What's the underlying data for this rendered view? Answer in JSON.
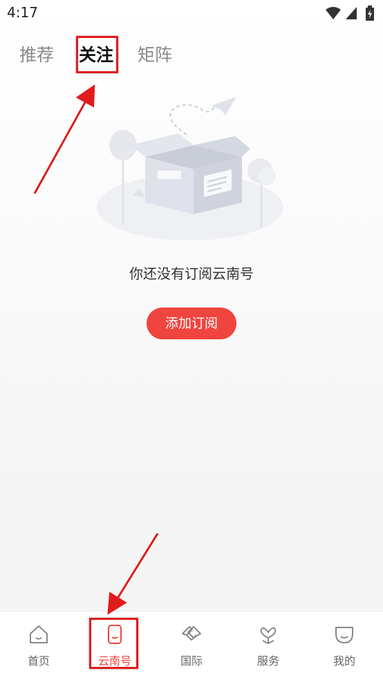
{
  "status_bar": {
    "time": "4:17",
    "icons": [
      "wifi-icon",
      "signal-icon",
      "battery-icon"
    ]
  },
  "top_tabs": [
    {
      "label": "推荐",
      "active": false
    },
    {
      "label": "关注",
      "active": true
    },
    {
      "label": "矩阵",
      "active": false
    }
  ],
  "empty_state": {
    "message": "你还没有订阅云南号",
    "button_label": "添加订阅",
    "illustration": "empty-box-illustration"
  },
  "bottom_nav": [
    {
      "label": "首页",
      "icon": "home-icon",
      "active": false
    },
    {
      "label": "云南号",
      "icon": "phone-icon",
      "active": true
    },
    {
      "label": "国际",
      "icon": "handshake-icon",
      "active": false
    },
    {
      "label": "服务",
      "icon": "service-icon",
      "active": false
    },
    {
      "label": "我的",
      "icon": "profile-icon",
      "active": false
    }
  ],
  "colors": {
    "accent": "#f0443f",
    "annotation": "#e11b1b"
  }
}
